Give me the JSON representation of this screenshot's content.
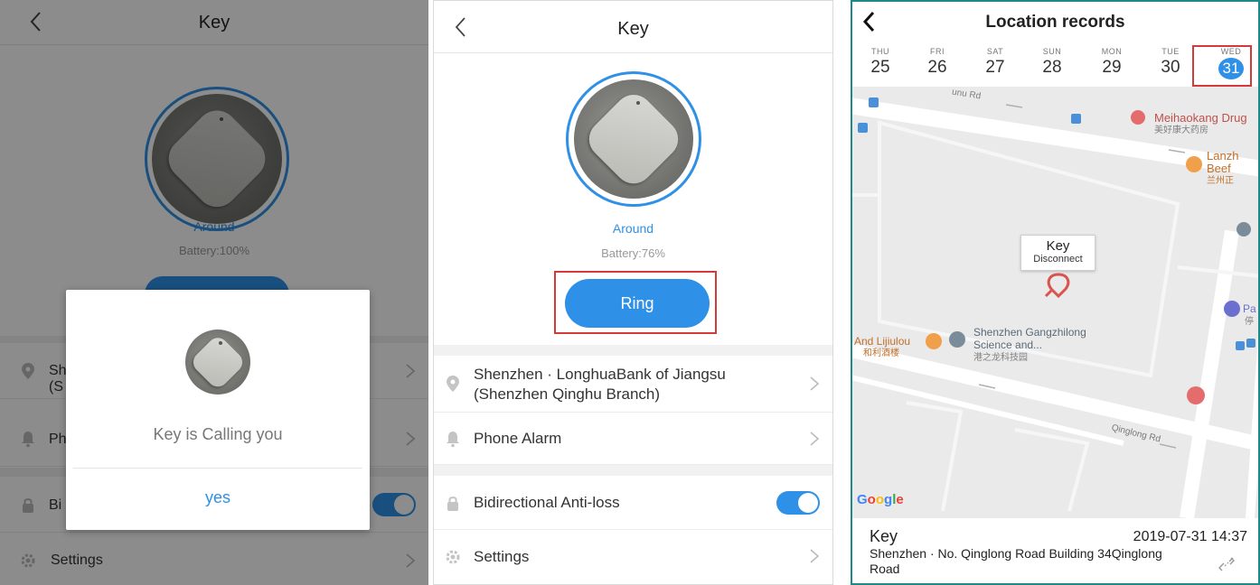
{
  "panel1": {
    "title": "Key",
    "status": "Around",
    "battery": "Battery:100%",
    "rows": {
      "location_partial": "Sh",
      "location_partial2": "(S",
      "alarm_partial": "Ph",
      "anti_loss_partial": "Bi",
      "settings": "Settings"
    },
    "dialog": {
      "message": "Key is Calling you",
      "button": "yes"
    }
  },
  "panel2": {
    "title": "Key",
    "status": "Around",
    "battery": "Battery:76%",
    "ring_button": "Ring",
    "location_line1": "Shenzhen · LonghuaBank of Jiangsu",
    "location_line2": "(Shenzhen Qinghu Branch)",
    "phone_alarm": "Phone Alarm",
    "anti_loss": "Bidirectional Anti-loss",
    "settings": "Settings",
    "anti_loss_enabled": true
  },
  "panel3": {
    "title": "Location records",
    "days": [
      {
        "name": "THU",
        "date": "25"
      },
      {
        "name": "FRI",
        "date": "26"
      },
      {
        "name": "SAT",
        "date": "27"
      },
      {
        "name": "SUN",
        "date": "28"
      },
      {
        "name": "MON",
        "date": "29"
      },
      {
        "name": "TUE",
        "date": "30"
      },
      {
        "name": "WED",
        "date": "31"
      }
    ],
    "selected_day": "31",
    "map": {
      "road_top": "unu Rd",
      "poi_pharmacy": "Meihaokang Drug",
      "poi_pharmacy_cn": "美好康大药房",
      "poi_lanzhou_1": "Lanzh",
      "poi_lanzhou_2": "Beef",
      "poi_lanzhou_cn": "兰州正",
      "poi_restaurant_1": "And Lijiulou",
      "poi_restaurant_cn": "和利酒楼",
      "poi_science_1": "Shenzhen Gangzhilong",
      "poi_science_2": "Science and...",
      "poi_science_cn": "港之龙科技园",
      "poi_parking": "Pa",
      "poi_parking_cn": "停",
      "road_qinglong": "Qinglong Rd",
      "callout_title": "Key",
      "callout_status": "Disconnect",
      "attribution": "Google"
    },
    "record": {
      "name": "Key",
      "time": "2019-07-31 14:37",
      "address": "Shenzhen · No. Qinglong Road Building 34Qinglong Road"
    }
  },
  "colors": {
    "accent": "#2e90e6",
    "highlight_box": "#d33a3a",
    "marker_red": "#d9534f"
  }
}
